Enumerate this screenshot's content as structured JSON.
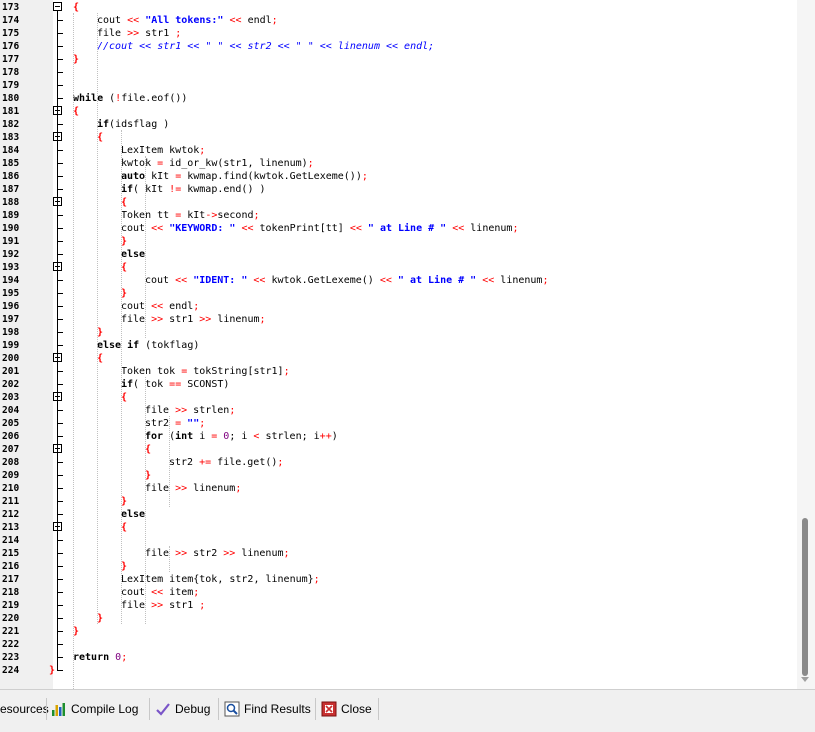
{
  "editor": {
    "lines": [
      {
        "n": "173",
        "indent": 2,
        "tokens": [
          {
            "t": "{",
            "c": "br"
          }
        ]
      },
      {
        "n": "174",
        "indent": 3,
        "tokens": [
          {
            "t": "cout ",
            "c": ""
          },
          {
            "t": "<<",
            "c": "sym"
          },
          {
            "t": " ",
            "c": ""
          },
          {
            "t": "\"All tokens:\"",
            "c": "str"
          },
          {
            "t": " ",
            "c": ""
          },
          {
            "t": "<<",
            "c": "sym"
          },
          {
            "t": " endl",
            "c": ""
          },
          {
            "t": ";",
            "c": "sym"
          }
        ]
      },
      {
        "n": "175",
        "indent": 3,
        "tokens": [
          {
            "t": "file ",
            "c": ""
          },
          {
            "t": ">>",
            "c": "sym"
          },
          {
            "t": " str1 ",
            "c": ""
          },
          {
            "t": ";",
            "c": "sym"
          }
        ]
      },
      {
        "n": "176",
        "indent": 3,
        "tokens": [
          {
            "t": "//cout << str1 << \" \" << str2 << \" \" << linenum << endl;",
            "c": "cmt"
          }
        ]
      },
      {
        "n": "177",
        "indent": 2,
        "tokens": [
          {
            "t": "}",
            "c": "br"
          }
        ]
      },
      {
        "n": "178",
        "indent": 0,
        "tokens": []
      },
      {
        "n": "179",
        "indent": 0,
        "tokens": []
      },
      {
        "n": "180",
        "indent": 2,
        "tokens": [
          {
            "t": "while",
            "c": "kw"
          },
          {
            "t": " (",
            "c": ""
          },
          {
            "t": "!",
            "c": "sym"
          },
          {
            "t": "file.eof())",
            "c": ""
          }
        ]
      },
      {
        "n": "181",
        "indent": 2,
        "tokens": [
          {
            "t": "{",
            "c": "br"
          }
        ]
      },
      {
        "n": "182",
        "indent": 3,
        "tokens": [
          {
            "t": "if",
            "c": "kw"
          },
          {
            "t": "(idsflag )",
            "c": ""
          }
        ]
      },
      {
        "n": "183",
        "indent": 3,
        "tokens": [
          {
            "t": "{",
            "c": "br"
          }
        ]
      },
      {
        "n": "184",
        "indent": 4,
        "tokens": [
          {
            "t": "LexItem kwtok",
            "c": ""
          },
          {
            "t": ";",
            "c": "sym"
          }
        ]
      },
      {
        "n": "185",
        "indent": 4,
        "tokens": [
          {
            "t": "kwtok ",
            "c": ""
          },
          {
            "t": "=",
            "c": "sym"
          },
          {
            "t": " id_or_kw(str1, linenum)",
            "c": ""
          },
          {
            "t": ";",
            "c": "sym"
          }
        ]
      },
      {
        "n": "186",
        "indent": 4,
        "tokens": [
          {
            "t": "auto",
            "c": "kw"
          },
          {
            "t": " kIt ",
            "c": ""
          },
          {
            "t": "=",
            "c": "sym"
          },
          {
            "t": " kwmap.find(kwtok.GetLexeme())",
            "c": ""
          },
          {
            "t": ";",
            "c": "sym"
          }
        ]
      },
      {
        "n": "187",
        "indent": 4,
        "tokens": [
          {
            "t": "if",
            "c": "kw"
          },
          {
            "t": "( kIt ",
            "c": ""
          },
          {
            "t": "!=",
            "c": "sym"
          },
          {
            "t": " kwmap.end() )",
            "c": ""
          }
        ]
      },
      {
        "n": "188",
        "indent": 4,
        "tokens": [
          {
            "t": "{",
            "c": "br"
          }
        ]
      },
      {
        "n": "189",
        "indent": 4,
        "tokens": [
          {
            "t": "Token tt ",
            "c": ""
          },
          {
            "t": "=",
            "c": "sym"
          },
          {
            "t": " kIt",
            "c": ""
          },
          {
            "t": "->",
            "c": "sym"
          },
          {
            "t": "second",
            "c": ""
          },
          {
            "t": ";",
            "c": "sym"
          }
        ]
      },
      {
        "n": "190",
        "indent": 4,
        "tokens": [
          {
            "t": "cout ",
            "c": ""
          },
          {
            "t": "<<",
            "c": "sym"
          },
          {
            "t": " ",
            "c": ""
          },
          {
            "t": "\"KEYWORD: \"",
            "c": "str"
          },
          {
            "t": " ",
            "c": ""
          },
          {
            "t": "<<",
            "c": "sym"
          },
          {
            "t": " tokenPrint[tt] ",
            "c": ""
          },
          {
            "t": "<<",
            "c": "sym"
          },
          {
            "t": " ",
            "c": ""
          },
          {
            "t": "\" at Line # \"",
            "c": "str"
          },
          {
            "t": " ",
            "c": ""
          },
          {
            "t": "<<",
            "c": "sym"
          },
          {
            "t": " linenum",
            "c": ""
          },
          {
            "t": ";",
            "c": "sym"
          }
        ]
      },
      {
        "n": "191",
        "indent": 4,
        "tokens": [
          {
            "t": "}",
            "c": "br"
          }
        ]
      },
      {
        "n": "192",
        "indent": 4,
        "tokens": [
          {
            "t": "else",
            "c": "kw"
          }
        ]
      },
      {
        "n": "193",
        "indent": 4,
        "tokens": [
          {
            "t": "{",
            "c": "br"
          }
        ]
      },
      {
        "n": "194",
        "indent": 5,
        "tokens": [
          {
            "t": "cout ",
            "c": ""
          },
          {
            "t": "<<",
            "c": "sym"
          },
          {
            "t": " ",
            "c": ""
          },
          {
            "t": "\"IDENT: \"",
            "c": "str"
          },
          {
            "t": " ",
            "c": ""
          },
          {
            "t": "<<",
            "c": "sym"
          },
          {
            "t": " kwtok.GetLexeme() ",
            "c": ""
          },
          {
            "t": "<<",
            "c": "sym"
          },
          {
            "t": " ",
            "c": ""
          },
          {
            "t": "\" at Line # \"",
            "c": "str"
          },
          {
            "t": " ",
            "c": ""
          },
          {
            "t": "<<",
            "c": "sym"
          },
          {
            "t": " linenum",
            "c": ""
          },
          {
            "t": ";",
            "c": "sym"
          }
        ]
      },
      {
        "n": "195",
        "indent": 4,
        "tokens": [
          {
            "t": "}",
            "c": "br"
          }
        ]
      },
      {
        "n": "196",
        "indent": 4,
        "tokens": [
          {
            "t": "cout ",
            "c": ""
          },
          {
            "t": "<<",
            "c": "sym"
          },
          {
            "t": " endl",
            "c": ""
          },
          {
            "t": ";",
            "c": "sym"
          }
        ]
      },
      {
        "n": "197",
        "indent": 4,
        "tokens": [
          {
            "t": "file ",
            "c": ""
          },
          {
            "t": ">>",
            "c": "sym"
          },
          {
            "t": " str1 ",
            "c": ""
          },
          {
            "t": ">>",
            "c": "sym"
          },
          {
            "t": " linenum",
            "c": ""
          },
          {
            "t": ";",
            "c": "sym"
          }
        ]
      },
      {
        "n": "198",
        "indent": 3,
        "tokens": [
          {
            "t": "}",
            "c": "br"
          }
        ]
      },
      {
        "n": "199",
        "indent": 3,
        "tokens": [
          {
            "t": "else if",
            "c": "kw"
          },
          {
            "t": " (tokflag)",
            "c": ""
          }
        ]
      },
      {
        "n": "200",
        "indent": 3,
        "tokens": [
          {
            "t": "{",
            "c": "br"
          }
        ]
      },
      {
        "n": "201",
        "indent": 4,
        "tokens": [
          {
            "t": "Token tok ",
            "c": ""
          },
          {
            "t": "=",
            "c": "sym"
          },
          {
            "t": " tokString[str1]",
            "c": ""
          },
          {
            "t": ";",
            "c": "sym"
          }
        ]
      },
      {
        "n": "202",
        "indent": 4,
        "tokens": [
          {
            "t": "if",
            "c": "kw"
          },
          {
            "t": "( tok ",
            "c": ""
          },
          {
            "t": "==",
            "c": "sym"
          },
          {
            "t": " SCONST)",
            "c": ""
          }
        ]
      },
      {
        "n": "203",
        "indent": 4,
        "tokens": [
          {
            "t": "{",
            "c": "br"
          }
        ]
      },
      {
        "n": "204",
        "indent": 5,
        "tokens": [
          {
            "t": "file ",
            "c": ""
          },
          {
            "t": ">>",
            "c": "sym"
          },
          {
            "t": " strlen",
            "c": ""
          },
          {
            "t": ";",
            "c": "sym"
          }
        ]
      },
      {
        "n": "205",
        "indent": 5,
        "tokens": [
          {
            "t": "str2 ",
            "c": ""
          },
          {
            "t": "=",
            "c": "sym"
          },
          {
            "t": " ",
            "c": ""
          },
          {
            "t": "\"\"",
            "c": "str"
          },
          {
            "t": ";",
            "c": "sym"
          }
        ]
      },
      {
        "n": "206",
        "indent": 5,
        "tokens": [
          {
            "t": "for",
            "c": "kw"
          },
          {
            "t": " (",
            "c": ""
          },
          {
            "t": "int",
            "c": "kw"
          },
          {
            "t": " i ",
            "c": ""
          },
          {
            "t": "=",
            "c": "sym"
          },
          {
            "t": " ",
            "c": ""
          },
          {
            "t": "0",
            "c": "num"
          },
          {
            "t": "; i ",
            "c": ""
          },
          {
            "t": "<",
            "c": "sym"
          },
          {
            "t": " strlen; i",
            "c": ""
          },
          {
            "t": "++",
            "c": "sym"
          },
          {
            "t": ")",
            "c": ""
          }
        ]
      },
      {
        "n": "207",
        "indent": 5,
        "tokens": [
          {
            "t": "{",
            "c": "br"
          }
        ]
      },
      {
        "n": "208",
        "indent": 6,
        "tokens": [
          {
            "t": "str2 ",
            "c": ""
          },
          {
            "t": "+=",
            "c": "sym"
          },
          {
            "t": " file.get()",
            "c": ""
          },
          {
            "t": ";",
            "c": "sym"
          }
        ]
      },
      {
        "n": "209",
        "indent": 5,
        "tokens": [
          {
            "t": "}",
            "c": "br"
          }
        ]
      },
      {
        "n": "210",
        "indent": 5,
        "tokens": [
          {
            "t": "file ",
            "c": ""
          },
          {
            "t": ">>",
            "c": "sym"
          },
          {
            "t": " linenum",
            "c": ""
          },
          {
            "t": ";",
            "c": "sym"
          }
        ]
      },
      {
        "n": "211",
        "indent": 4,
        "tokens": [
          {
            "t": "}",
            "c": "br"
          }
        ]
      },
      {
        "n": "212",
        "indent": 4,
        "tokens": [
          {
            "t": "else",
            "c": "kw"
          }
        ]
      },
      {
        "n": "213",
        "indent": 4,
        "tokens": [
          {
            "t": "{",
            "c": "br"
          }
        ]
      },
      {
        "n": "214",
        "indent": 0,
        "tokens": []
      },
      {
        "n": "215",
        "indent": 5,
        "tokens": [
          {
            "t": "file ",
            "c": ""
          },
          {
            "t": ">>",
            "c": "sym"
          },
          {
            "t": " str2 ",
            "c": ""
          },
          {
            "t": ">>",
            "c": "sym"
          },
          {
            "t": " linenum",
            "c": ""
          },
          {
            "t": ";",
            "c": "sym"
          }
        ]
      },
      {
        "n": "216",
        "indent": 4,
        "tokens": [
          {
            "t": "}",
            "c": "br"
          }
        ]
      },
      {
        "n": "217",
        "indent": 4,
        "tokens": [
          {
            "t": "LexItem item{tok, str2, linenum}",
            "c": ""
          },
          {
            "t": ";",
            "c": "sym"
          }
        ]
      },
      {
        "n": "218",
        "indent": 4,
        "tokens": [
          {
            "t": "cout ",
            "c": ""
          },
          {
            "t": "<<",
            "c": "sym"
          },
          {
            "t": " item",
            "c": ""
          },
          {
            "t": ";",
            "c": "sym"
          }
        ]
      },
      {
        "n": "219",
        "indent": 4,
        "tokens": [
          {
            "t": "file ",
            "c": ""
          },
          {
            "t": ">>",
            "c": "sym"
          },
          {
            "t": " str1 ",
            "c": ""
          },
          {
            "t": ";",
            "c": "sym"
          }
        ]
      },
      {
        "n": "220",
        "indent": 3,
        "tokens": [
          {
            "t": "}",
            "c": "br"
          }
        ]
      },
      {
        "n": "221",
        "indent": 2,
        "tokens": [
          {
            "t": "}",
            "c": "br"
          }
        ]
      },
      {
        "n": "222",
        "indent": 0,
        "tokens": []
      },
      {
        "n": "223",
        "indent": 2,
        "tokens": [
          {
            "t": "return",
            "c": "kw"
          },
          {
            "t": " ",
            "c": ""
          },
          {
            "t": "0",
            "c": "num"
          },
          {
            "t": ";",
            "c": "sym"
          }
        ]
      },
      {
        "n": "224",
        "indent": 1,
        "tokens": [
          {
            "t": "}",
            "c": "br"
          }
        ]
      }
    ],
    "fold_markers": [
      "173",
      "181",
      "183",
      "188",
      "193",
      "200",
      "203",
      "207",
      "213"
    ]
  },
  "bottom_tabs": [
    {
      "label": "esources",
      "icon": "resources-icon"
    },
    {
      "label": "Compile Log",
      "icon": "compile-log-icon"
    },
    {
      "label": "Debug",
      "icon": "debug-check-icon"
    },
    {
      "label": "Find Results",
      "icon": "find-results-icon"
    },
    {
      "label": "Close",
      "icon": "close-icon"
    }
  ],
  "colors": {
    "keyword": "#000000",
    "string": "#0000ff",
    "comment": "#0000ff",
    "brace": "#ff0000",
    "symbol": "#ff0000",
    "number": "#800080",
    "gutter": "#f0f0f0"
  }
}
